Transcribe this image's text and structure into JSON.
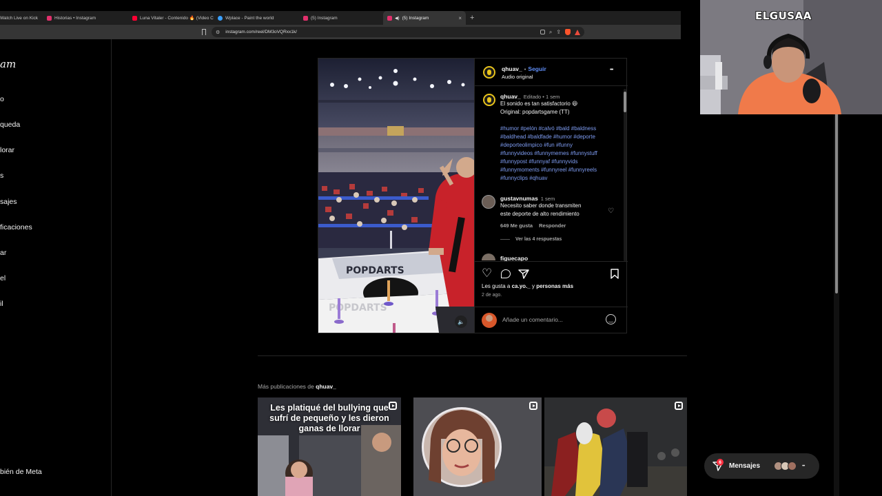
{
  "tabs": [
    {
      "label": "Watch Live on Kick",
      "color": "#53fc18",
      "active": false
    },
    {
      "label": "Historias • Instagram",
      "color": "#e1306c",
      "active": false
    },
    {
      "label": "Luna Vitaler - Contenido 🔥 (Video C",
      "color": "#ff0033",
      "active": false
    },
    {
      "label": "Wplace - Paint the world",
      "color": "#3aa0ff",
      "active": false
    },
    {
      "label": "(5) Instagram",
      "color": "#e1306c",
      "active": false
    },
    {
      "label": "(5) Instagram",
      "color": "#e1306c",
      "active": true
    }
  ],
  "address": {
    "url": "instagram.com/reel/DM3oVQRxx1k/"
  },
  "sidebar": {
    "logo": "am",
    "items": [
      {
        "label": "o"
      },
      {
        "label": "queda"
      },
      {
        "label": "lorar"
      },
      {
        "label": "s"
      },
      {
        "label": "sajes"
      },
      {
        "label": "ficaciones"
      },
      {
        "label": "ar"
      },
      {
        "label": "el"
      },
      {
        "label": "il"
      }
    ],
    "meta": "bién de Meta"
  },
  "post": {
    "username": "qhuav_",
    "follow": "Seguir",
    "dot": "•",
    "audio": "Audio original",
    "more": "•••",
    "caption_user": "qhuav_",
    "caption_meta": "Editado • 1 sem",
    "caption_line1": "El sonido es tan satisfactorio 😆",
    "caption_line2": "Original: popdartsgame (TT)",
    "hashtags": [
      "#humor #pelón #calvó #bald #baldness",
      "#baldhead #baldfade #humor #deporte",
      "#deporteolimpico #fun #funny",
      "#funnyvideos #funnymemes #funnystuff",
      "#funnypost #funnyaf #funnyvids",
      "#funnymoments #funnyreel #funnyreels",
      "#funnyclips #qhuav"
    ],
    "comment1": {
      "user": "gustavnumas",
      "time": "1 sem",
      "text1": "Necesito saber donde transmiten",
      "text2": "este deporte de alto rendimiento",
      "likes": "649 Me gusta",
      "reply": "Responder",
      "view_replies": "Ver las 4 respuestas"
    },
    "comment2_user": "figuecapo",
    "likes_prefix": "Les gusta a",
    "likes_user": "ca.yo._",
    "likes_mid": "y",
    "likes_others": "personas más",
    "date": "2 de ago.",
    "comment_placeholder": "Añade un comentario..."
  },
  "video": {
    "brand": "POPDARTS"
  },
  "more_posts": {
    "prefix": "Más publicaciones de",
    "user": "qhuav_",
    "thumb1_caption": "Les platiqué del bullying que sufrí de pequeño y les dieron ganas de llorar"
  },
  "webcam": {
    "label": "ELGUSAA"
  },
  "messages": {
    "label": "Mensajes",
    "badge": "6",
    "more": "•••"
  }
}
